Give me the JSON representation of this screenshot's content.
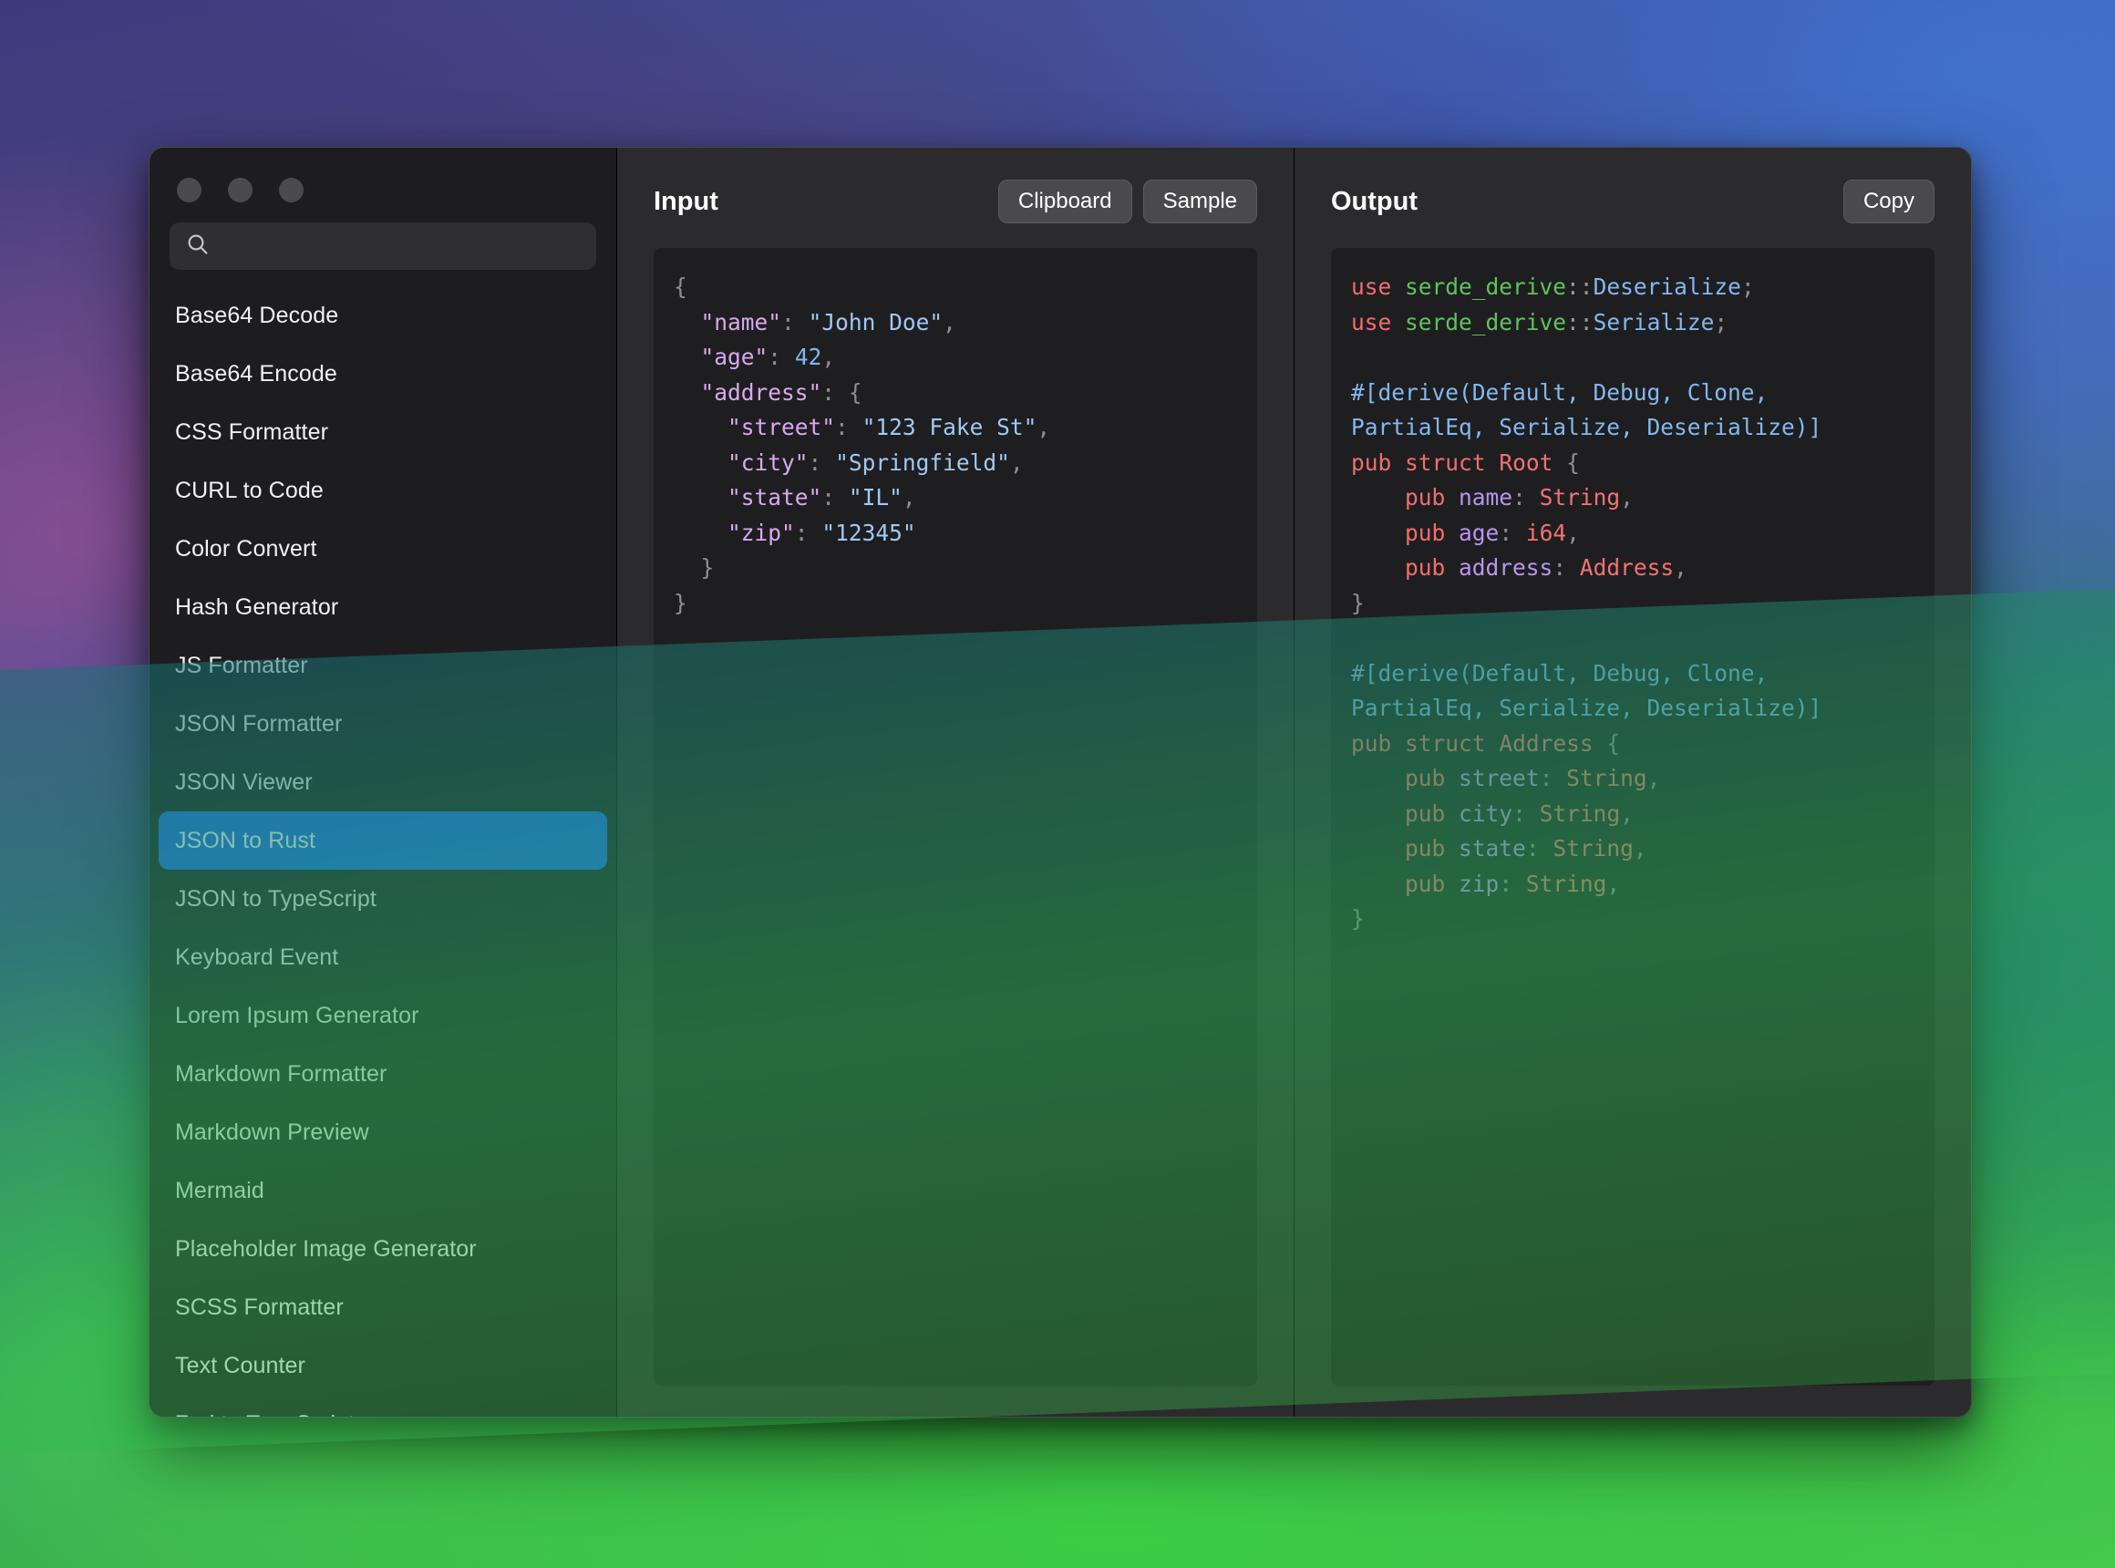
{
  "window": {
    "traffic_lights": [
      "close",
      "minimize",
      "zoom"
    ]
  },
  "sidebar": {
    "search": {
      "value": "",
      "placeholder": "",
      "icon": "search-icon"
    },
    "items": [
      {
        "label": "Base64 Decode",
        "selected": false
      },
      {
        "label": "Base64 Encode",
        "selected": false
      },
      {
        "label": "CSS Formatter",
        "selected": false
      },
      {
        "label": "CURL to Code",
        "selected": false
      },
      {
        "label": "Color Convert",
        "selected": false
      },
      {
        "label": "Hash Generator",
        "selected": false
      },
      {
        "label": "JS Formatter",
        "selected": false
      },
      {
        "label": "JSON Formatter",
        "selected": false
      },
      {
        "label": "JSON Viewer",
        "selected": false
      },
      {
        "label": "JSON to Rust",
        "selected": true
      },
      {
        "label": "JSON to TypeScript",
        "selected": false
      },
      {
        "label": "Keyboard Event",
        "selected": false
      },
      {
        "label": "Lorem Ipsum Generator",
        "selected": false
      },
      {
        "label": "Markdown Formatter",
        "selected": false
      },
      {
        "label": "Markdown Preview",
        "selected": false
      },
      {
        "label": "Mermaid",
        "selected": false
      },
      {
        "label": "Placeholder Image Generator",
        "selected": false
      },
      {
        "label": "SCSS Formatter",
        "selected": false
      },
      {
        "label": "Text Counter",
        "selected": false
      },
      {
        "label": "Zod to TypeScript",
        "selected": false
      }
    ]
  },
  "input_panel": {
    "title": "Input",
    "clipboard_label": "Clipboard",
    "sample_label": "Sample",
    "code": "{\n  \"name\": \"John Doe\",\n  \"age\": 42,\n  \"address\": {\n    \"street\": \"123 Fake St\",\n    \"city\": \"Springfield\",\n    \"state\": \"IL\",\n    \"zip\": \"12345\"\n  }\n}"
  },
  "output_panel": {
    "title": "Output",
    "copy_label": "Copy",
    "code": "use serde_derive::Deserialize;\nuse serde_derive::Serialize;\n\n#[derive(Default, Debug, Clone, PartialEq, Serialize, Deserialize)]\npub struct Root {\n    pub name: String,\n    pub age: i64,\n    pub address: Address,\n}\n\n#[derive(Default, Debug, Clone, PartialEq, Serialize, Deserialize)]\npub struct Address {\n    pub street: String,\n    pub city: String,\n    pub state: String,\n    pub zip: String,\n}"
  },
  "colors": {
    "accent": "#1c6ef2",
    "window_bg": "#2b2b2d",
    "sidebar_bg": "#1d1d1f",
    "code_bg": "#1e1e20",
    "json_key": "#d9a9f0",
    "json_string": "#9fc9f5",
    "json_number": "#7fb8f0",
    "rust_keyword": "#f26d6d",
    "rust_module": "#5cc45c",
    "rust_type": "#f47272",
    "rust_attribute": "#84b8f0",
    "rust_field": "#b995ee"
  }
}
